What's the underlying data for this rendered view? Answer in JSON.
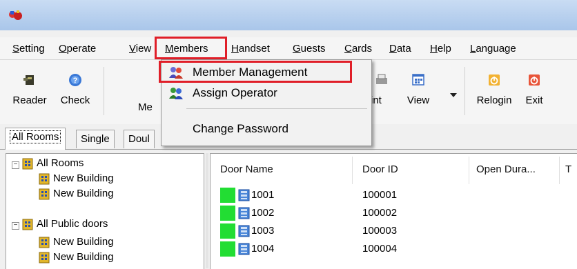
{
  "menubar": {
    "items": [
      {
        "label": "Setting",
        "accel": "S",
        "rest": "etting"
      },
      {
        "label": "Operate",
        "accel": "O",
        "rest": "perate"
      },
      {
        "label": "View",
        "accel": "V",
        "rest": "iew"
      },
      {
        "label": "Members",
        "accel": "M",
        "rest": "embers"
      },
      {
        "label": "Handset",
        "accel": "H",
        "rest": "andset"
      },
      {
        "label": "Guests",
        "accel": "G",
        "rest": "uests"
      },
      {
        "label": "Cards",
        "accel": "C",
        "rest": "ards"
      },
      {
        "label": "Data",
        "accel": "D",
        "rest": "ata"
      },
      {
        "label": "Help",
        "accel": "H",
        "rest": "elp"
      },
      {
        "label": "Language",
        "accel": "L",
        "rest": "anguage"
      }
    ]
  },
  "toolbar": {
    "reader": "Reader",
    "check": "Check",
    "member_partial": "Me",
    "print_partial": "rint",
    "view": "View",
    "relogin": "Relogin",
    "exit": "Exit"
  },
  "dropdown": {
    "member_management": "Member Management",
    "assign_operator": "Assign Operator",
    "change_password": "Change Password"
  },
  "tabs": [
    "All Rooms",
    "Single",
    "Doul"
  ],
  "tree": {
    "all_rooms": "All Rooms",
    "all_public_doors": "All Public doors",
    "building": "New Building"
  },
  "list": {
    "columns": [
      "Door Name",
      "Door ID",
      "Open Dura...",
      "T"
    ],
    "rows": [
      {
        "name": "1001",
        "id": "100001"
      },
      {
        "name": "1002",
        "id": "100002"
      },
      {
        "name": "1003",
        "id": "100003"
      },
      {
        "name": "1004",
        "id": "100004"
      }
    ]
  },
  "colors": {
    "highlight": "#e01e28",
    "status_green": "#22dd33",
    "titlebar": "#b8d1ef"
  }
}
